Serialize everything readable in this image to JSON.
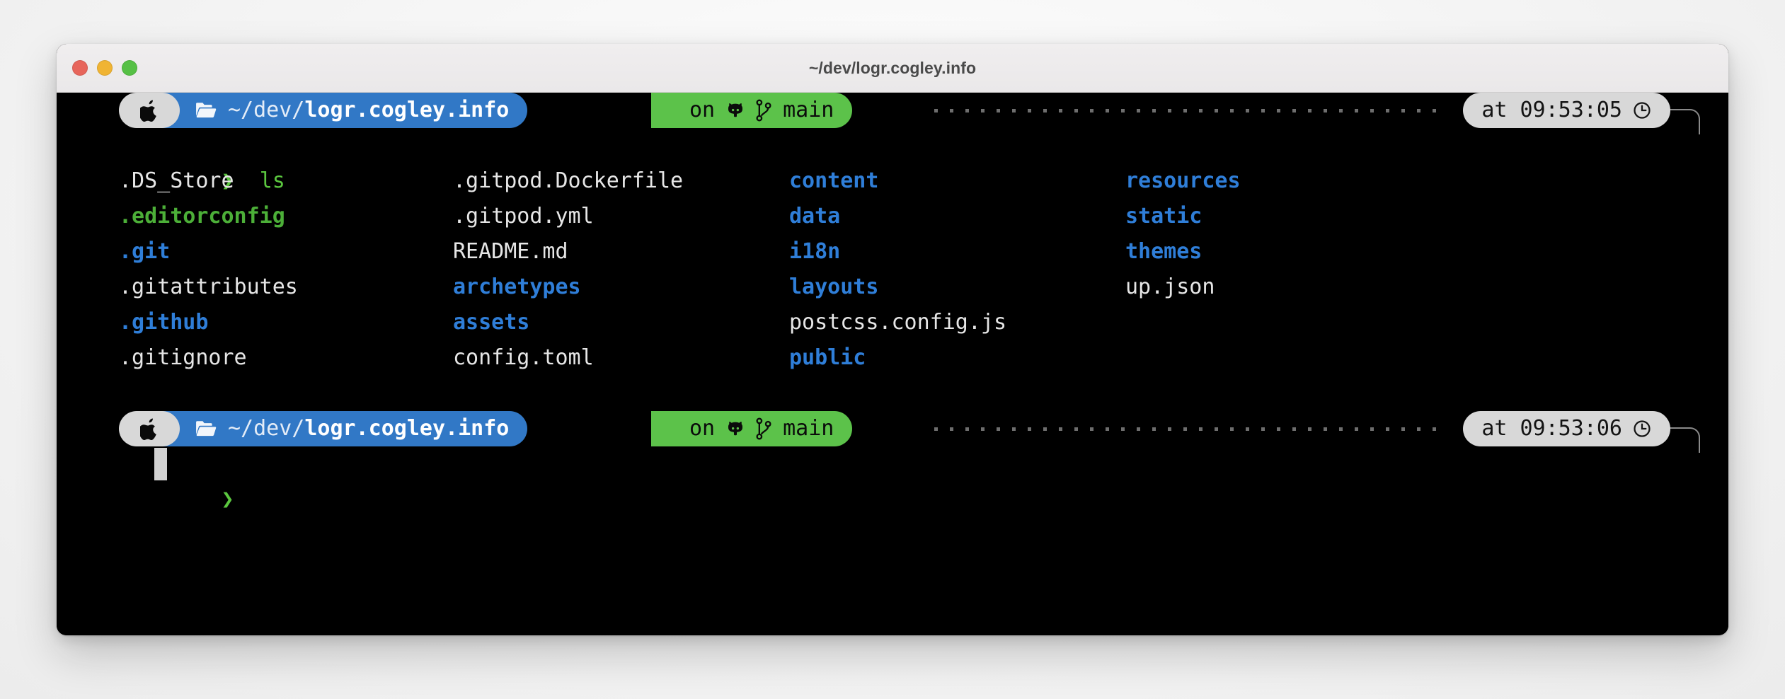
{
  "window": {
    "title": "~/dev/logr.cogley.info",
    "traffic_lights": [
      {
        "name": "close",
        "color": "#e7655b"
      },
      {
        "name": "minimize",
        "color": "#f0b433"
      },
      {
        "name": "zoom",
        "color": "#56c045"
      }
    ]
  },
  "theme": {
    "background": "#000000",
    "foreground": "#e6e6e6",
    "blue": "#2f7ed8",
    "green": "#4caf38",
    "prompt_blue": "#3178c6",
    "prompt_green": "#5cc24a",
    "pill_gray": "#d8d8d8",
    "cursor": "#d2d2d2"
  },
  "prompts": [
    {
      "apple_icon": "apple-icon",
      "folder_icon": "folder-icon",
      "path_prefix": "~/dev/",
      "path_name": "logr.cogley.info",
      "git_on": "on",
      "github_icon": "github-octocat-icon",
      "branch_icon": "git-branch-icon",
      "branch": "main",
      "time_prefix": "at",
      "time": "09:53:05",
      "clock_icon": "clock-icon"
    },
    {
      "apple_icon": "apple-icon",
      "folder_icon": "folder-icon",
      "path_prefix": "~/dev/",
      "path_name": "logr.cogley.info",
      "git_on": "on",
      "github_icon": "github-octocat-icon",
      "branch_icon": "git-branch-icon",
      "branch": "main",
      "time_prefix": "at",
      "time": "09:53:06",
      "clock_icon": "clock-icon"
    }
  ],
  "command_line": {
    "chevron": "❯",
    "command": "ls"
  },
  "input_line": {
    "chevron": "❯",
    "value": ""
  },
  "ls_output": {
    "columns": [
      {
        "entries": [
          {
            "name": ".DS_Store",
            "kind": "file"
          },
          {
            "name": ".editorconfig",
            "kind": "executable"
          },
          {
            "name": ".git",
            "kind": "directory"
          },
          {
            "name": ".gitattributes",
            "kind": "file"
          },
          {
            "name": ".github",
            "kind": "directory"
          },
          {
            "name": ".gitignore",
            "kind": "file"
          }
        ]
      },
      {
        "entries": [
          {
            "name": ".gitpod.Dockerfile",
            "kind": "file"
          },
          {
            "name": ".gitpod.yml",
            "kind": "file"
          },
          {
            "name": "README.md",
            "kind": "file"
          },
          {
            "name": "archetypes",
            "kind": "directory"
          },
          {
            "name": "assets",
            "kind": "directory"
          },
          {
            "name": "config.toml",
            "kind": "file"
          }
        ]
      },
      {
        "entries": [
          {
            "name": "content",
            "kind": "directory"
          },
          {
            "name": "data",
            "kind": "directory"
          },
          {
            "name": "i18n",
            "kind": "directory"
          },
          {
            "name": "layouts",
            "kind": "directory"
          },
          {
            "name": "postcss.config.js",
            "kind": "file"
          },
          {
            "name": "public",
            "kind": "directory"
          }
        ]
      },
      {
        "entries": [
          {
            "name": "resources",
            "kind": "directory"
          },
          {
            "name": "static",
            "kind": "directory"
          },
          {
            "name": "themes",
            "kind": "directory"
          },
          {
            "name": "up.json",
            "kind": "file"
          }
        ]
      }
    ]
  }
}
